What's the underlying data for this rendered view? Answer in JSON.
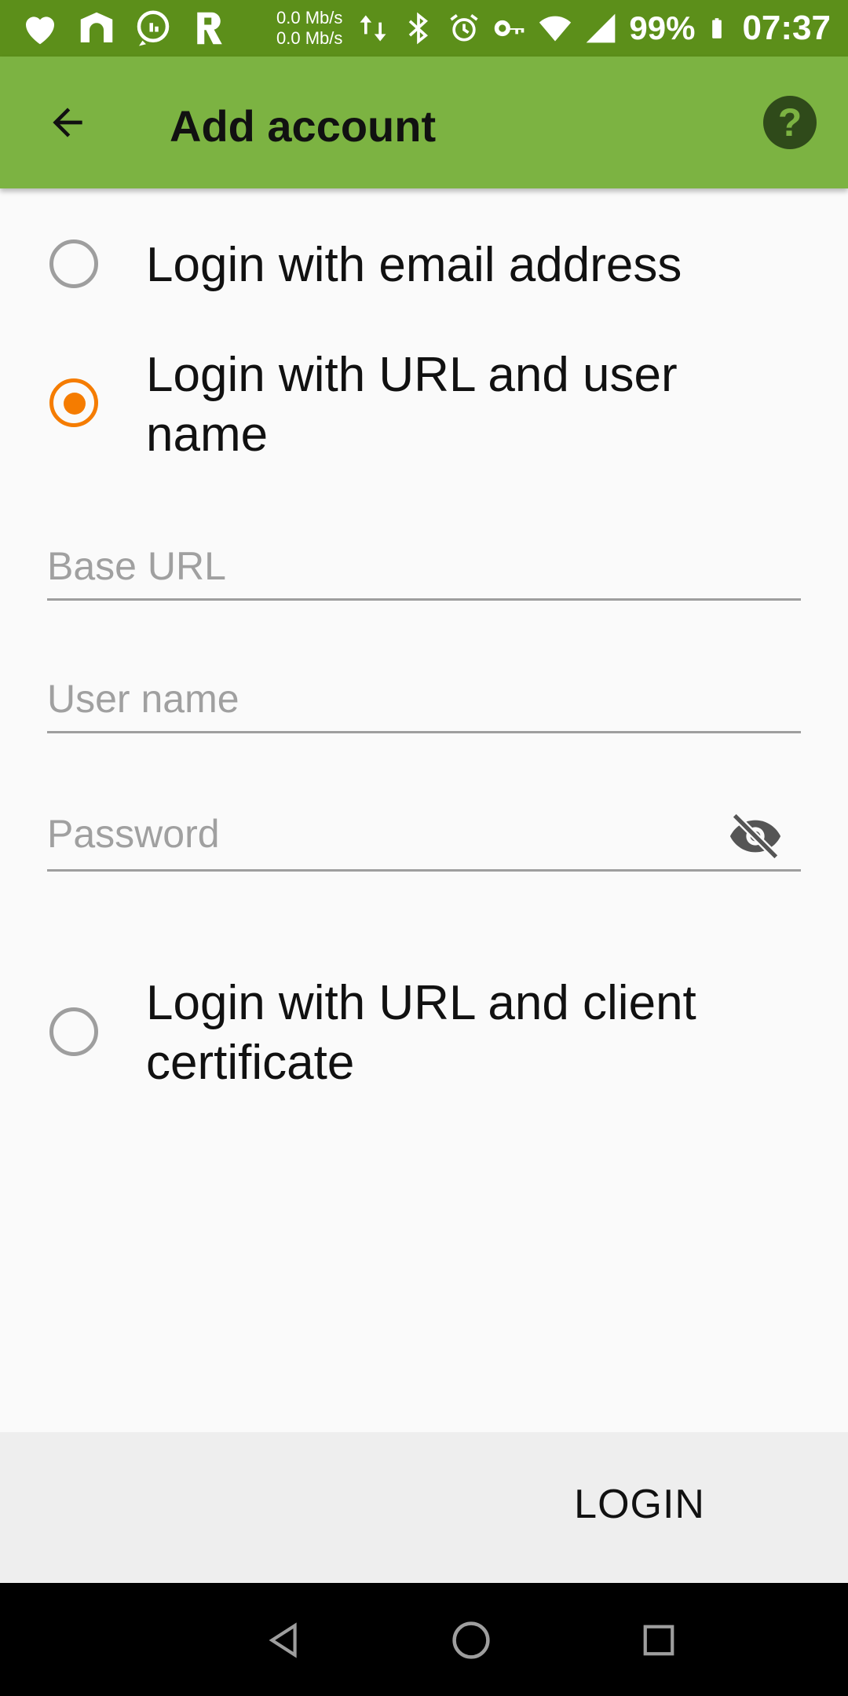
{
  "status_bar": {
    "net_up": "0.0 Mb/s",
    "net_down": "0.0 Mb/s",
    "battery": "99%",
    "time": "07:37",
    "icons": [
      "heart-icon",
      "shield-app-icon",
      "chat-app-icon",
      "r-app-icon",
      "data-arrows-icon",
      "bluetooth-icon",
      "alarm-icon",
      "vpn-key-icon",
      "wifi-icon",
      "signal-icon",
      "battery-icon"
    ]
  },
  "app_bar": {
    "title": "Add account",
    "back_icon": "arrow-back-icon",
    "help_icon": "help-icon"
  },
  "options": [
    {
      "label": "Login with email address",
      "selected": false
    },
    {
      "label": "Login with URL and user name",
      "selected": true
    },
    {
      "label": "Login with URL and client certificate",
      "selected": false
    }
  ],
  "fields": {
    "base_url": {
      "placeholder": "Base URL",
      "value": ""
    },
    "user_name": {
      "placeholder": "User name",
      "value": ""
    },
    "password": {
      "placeholder": "Password",
      "value": "",
      "toggle_icon": "visibility-off-icon"
    }
  },
  "actions": {
    "login_label": "LOGIN"
  },
  "colors": {
    "status_bar": "#5c8f1a",
    "app_bar": "#7cb342",
    "accent": "#f57c00"
  }
}
